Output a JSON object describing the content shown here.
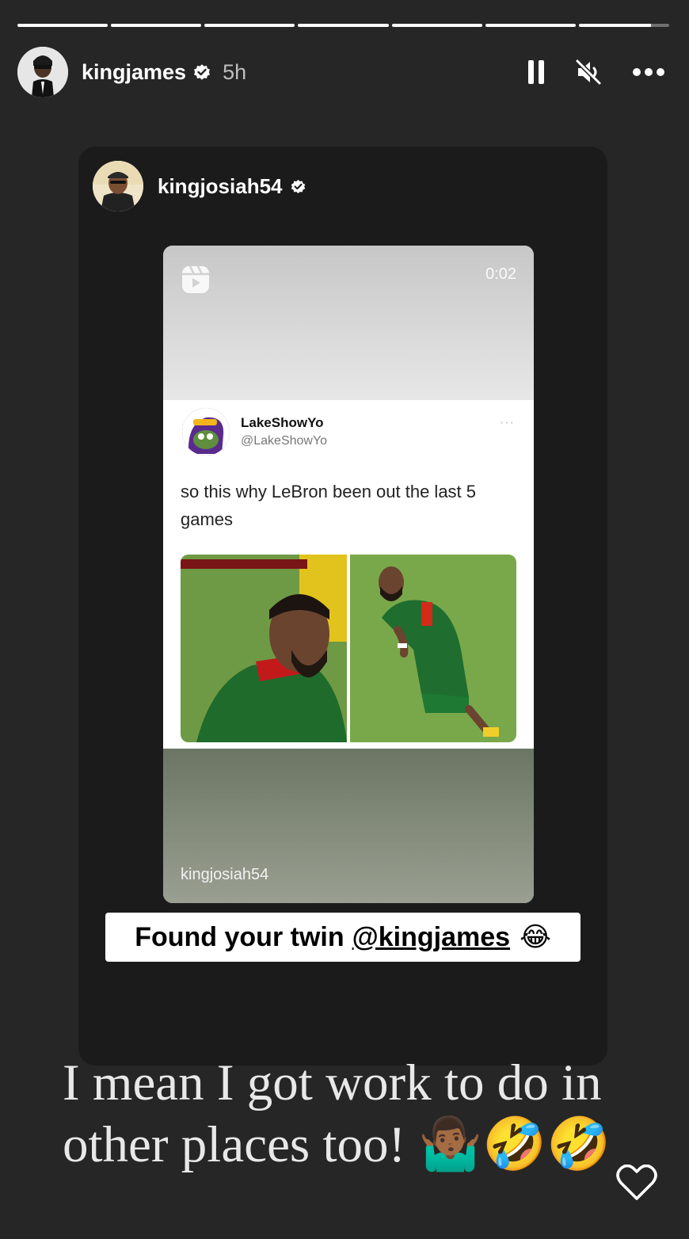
{
  "story": {
    "progress_segments": [
      1,
      1,
      1,
      1,
      1,
      1,
      0.8
    ],
    "author": "kingjames",
    "age": "5h"
  },
  "card": {
    "author": "kingjosiah54",
    "reel": {
      "duration": "0:02",
      "credit": "kingjosiah54",
      "tweet": {
        "name": "LakeShowYo",
        "handle": "@LakeShowYo",
        "more": "···",
        "text": "so this why LeBron been out the last 5 games"
      }
    },
    "sticker": {
      "text": "Found your twin",
      "mention": "@kingjames",
      "emoji": "😂"
    }
  },
  "caption": "I mean I got work to do in other places too! 🤷🏾‍♂️🤣🤣",
  "icons": {
    "pause": "pause-icon",
    "mute": "muted-speaker-icon",
    "more": "more-horizontal-icon",
    "like": "heart-icon"
  }
}
